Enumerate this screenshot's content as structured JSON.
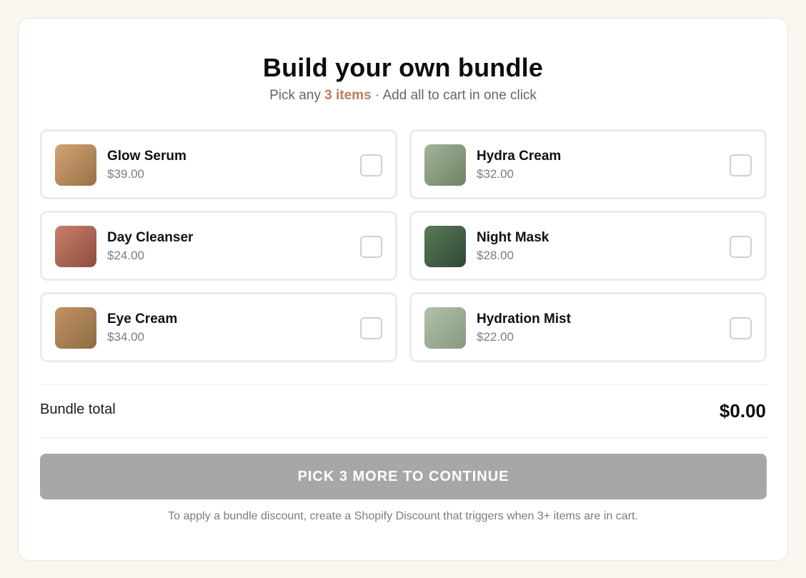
{
  "header": {
    "title": "Build your own bundle",
    "subtitle_prefix": "Pick any ",
    "subtitle_accent": "3 items",
    "subtitle_suffix": " · Add all to cart in one click"
  },
  "products": [
    {
      "name": "Glow Serum",
      "price": "$39.00",
      "color_a": "#d1a474",
      "color_b": "#9a7048",
      "selected": false
    },
    {
      "name": "Hydra Cream",
      "price": "$32.00",
      "color_a": "#a3b39a",
      "color_b": "#6c8463",
      "selected": false
    },
    {
      "name": "Day Cleanser",
      "price": "$24.00",
      "color_a": "#c97f6b",
      "color_b": "#8d4d3d",
      "selected": false
    },
    {
      "name": "Night Mask",
      "price": "$28.00",
      "color_a": "#5c7a58",
      "color_b": "#2e4734",
      "selected": false
    },
    {
      "name": "Eye Cream",
      "price": "$34.00",
      "color_a": "#c29462",
      "color_b": "#8c6b43",
      "selected": false
    },
    {
      "name": "Hydration Mist",
      "price": "$22.00",
      "color_a": "#b2c0a8",
      "color_b": "#869a80",
      "selected": false
    }
  ],
  "summary": {
    "total_label": "Bundle total",
    "total_value": "$0.00"
  },
  "cta": {
    "label": "PICK 3 MORE TO CONTINUE",
    "enabled": false
  },
  "footer": {
    "note": "To apply a bundle discount, create a Shopify Discount that triggers when 3+ items are in cart."
  },
  "colors": {
    "accent": "#c07a5e",
    "cta_disabled": "#a5a8a6",
    "page_bg": "#f9f6ef"
  }
}
